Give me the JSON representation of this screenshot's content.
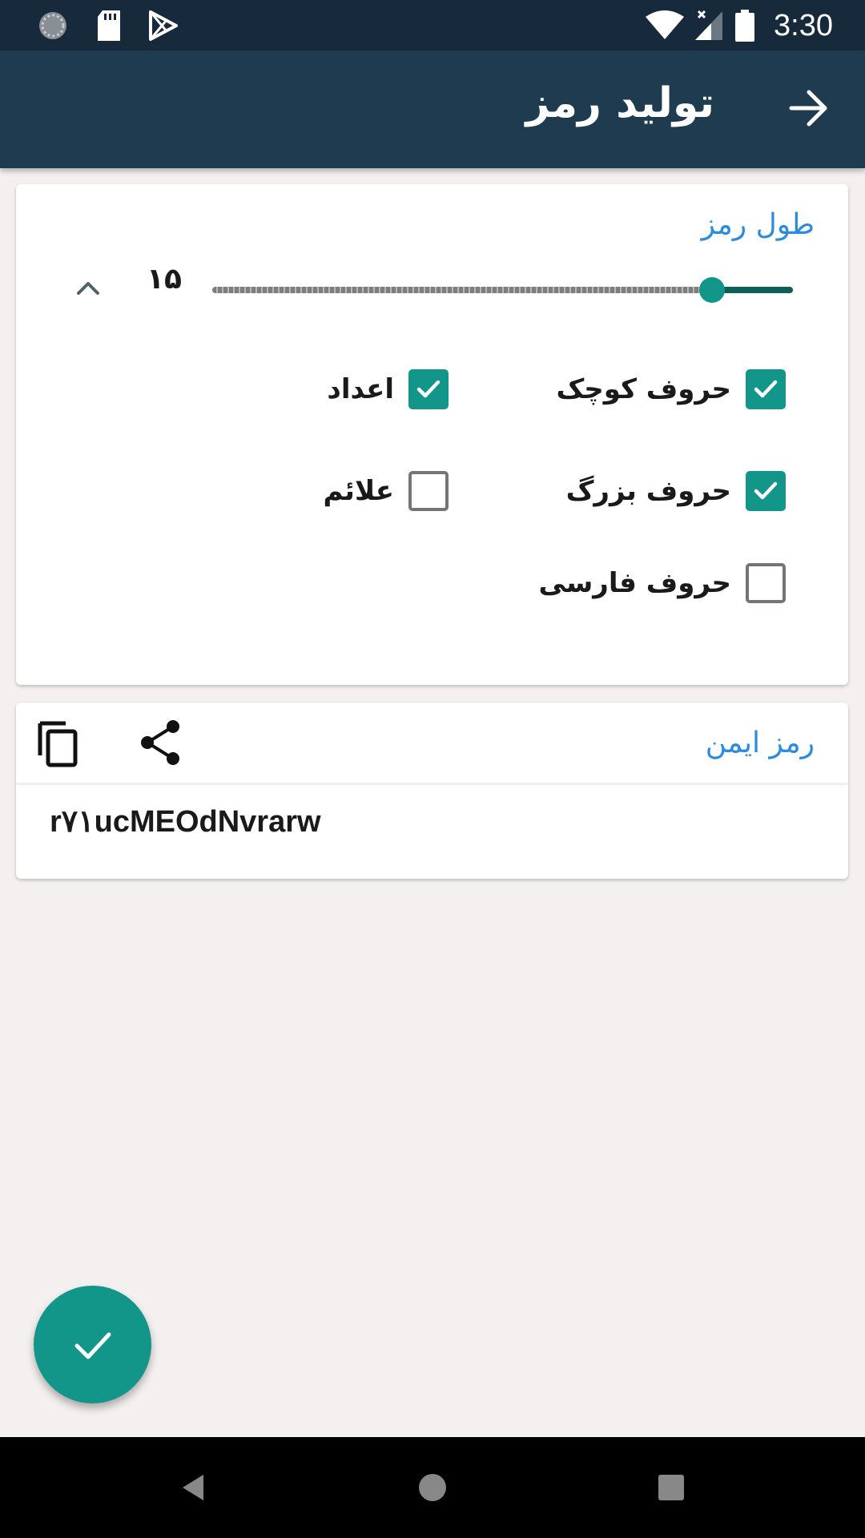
{
  "status_bar": {
    "time": "3:30",
    "left_icons": [
      "loading-circle-icon",
      "sd-card-icon",
      "play-store-icon"
    ],
    "right_icons": [
      "wifi-icon",
      "signal-no-data-icon",
      "battery-icon"
    ]
  },
  "app_bar": {
    "title": "تولید رمز",
    "back_icon": "arrow-right-icon"
  },
  "settings": {
    "length_label": "طول رمز",
    "length_value": "۱۵",
    "slider_fraction": 0.14,
    "options": [
      {
        "label": "حروف کوچک",
        "checked": true
      },
      {
        "label": "اعداد",
        "checked": true
      },
      {
        "label": "حروف بزرگ",
        "checked": true
      },
      {
        "label": "علائم",
        "checked": false
      },
      {
        "label": "حروف فارسی",
        "checked": false
      }
    ]
  },
  "result": {
    "label": "رمز ایمن",
    "password": "r۷۱ucMEOdNvrarw"
  },
  "fab": {
    "icon": "check-icon"
  },
  "colors": {
    "accent": "#12968a",
    "status_bar": "#172a3b",
    "app_bar": "#1e3b4f",
    "label_blue": "#2a8be0",
    "background": "#f4f0ef"
  }
}
